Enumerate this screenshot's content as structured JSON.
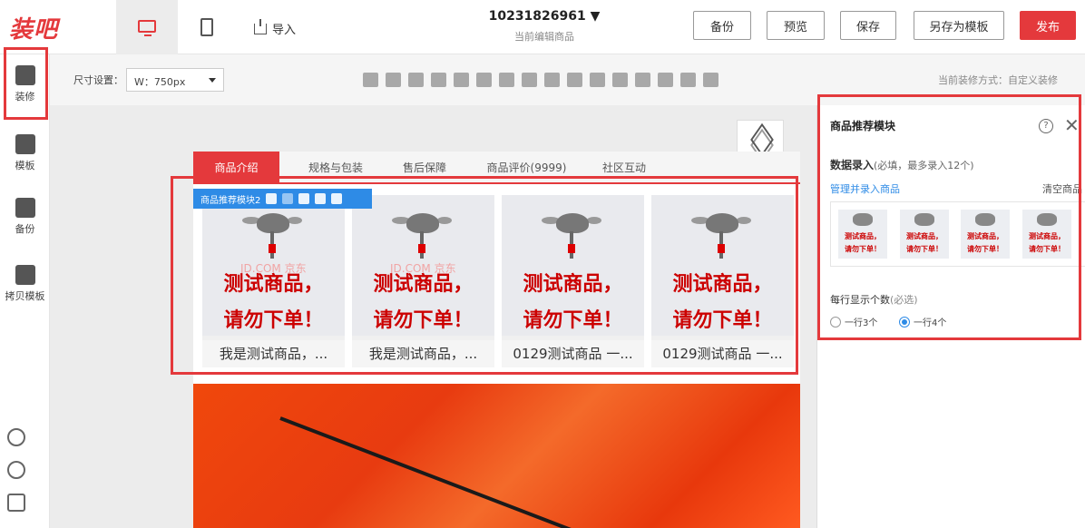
{
  "header": {
    "logo": "装吧",
    "import_label": "导入",
    "project_id": "10231826961",
    "project_sub": "当前编辑商品",
    "buttons": [
      "备份",
      "预览",
      "保存",
      "另存为模板",
      "发布"
    ]
  },
  "sidebar": {
    "items": [
      {
        "label": "装修",
        "icon": "paint-roller-icon"
      },
      {
        "label": "模板",
        "icon": "shirt-icon"
      },
      {
        "label": "备份",
        "icon": "backup-icon"
      },
      {
        "label": "拷贝模板",
        "icon": "copy-template-icon"
      }
    ],
    "bottom_icons": [
      "help-icon",
      "headset-icon",
      "feedback-icon"
    ]
  },
  "toolbar": {
    "size_label": "尺寸设置：",
    "size_value": "W：750px",
    "mode_text": "当前装修方式：自定义装修"
  },
  "page": {
    "tabs": [
      "商品介绍",
      "规格与包装",
      "售后保障",
      "商品评价(9999)",
      "社区互动"
    ],
    "module_label": "商品推荐模块2",
    "watermark": "JD.COM 京东",
    "product_text_line1": "测试商品，",
    "product_text_line2": "请勿下单！",
    "products": [
      {
        "name": "我是测试商品，..."
      },
      {
        "name": "我是测试商品，..."
      },
      {
        "name": "0129测试商品 一..."
      },
      {
        "name": "0129测试商品 一..."
      }
    ]
  },
  "panel": {
    "title": "商品推荐模块",
    "data_label": "数据录入",
    "data_hint": "(必填，最多录入12个)",
    "manage_link": "管理并录入商品",
    "clear_link": "清空商品",
    "thumb_line1": "测试商品，",
    "thumb_line2": "请勿下单！",
    "per_row_label": "每行显示个数",
    "per_row_hint": "(必选)",
    "options": [
      {
        "label": "一行3个",
        "selected": false
      },
      {
        "label": "一行4个",
        "selected": true
      }
    ]
  },
  "colors": {
    "brand": "#e4393c",
    "accent": "#2e8be6"
  }
}
